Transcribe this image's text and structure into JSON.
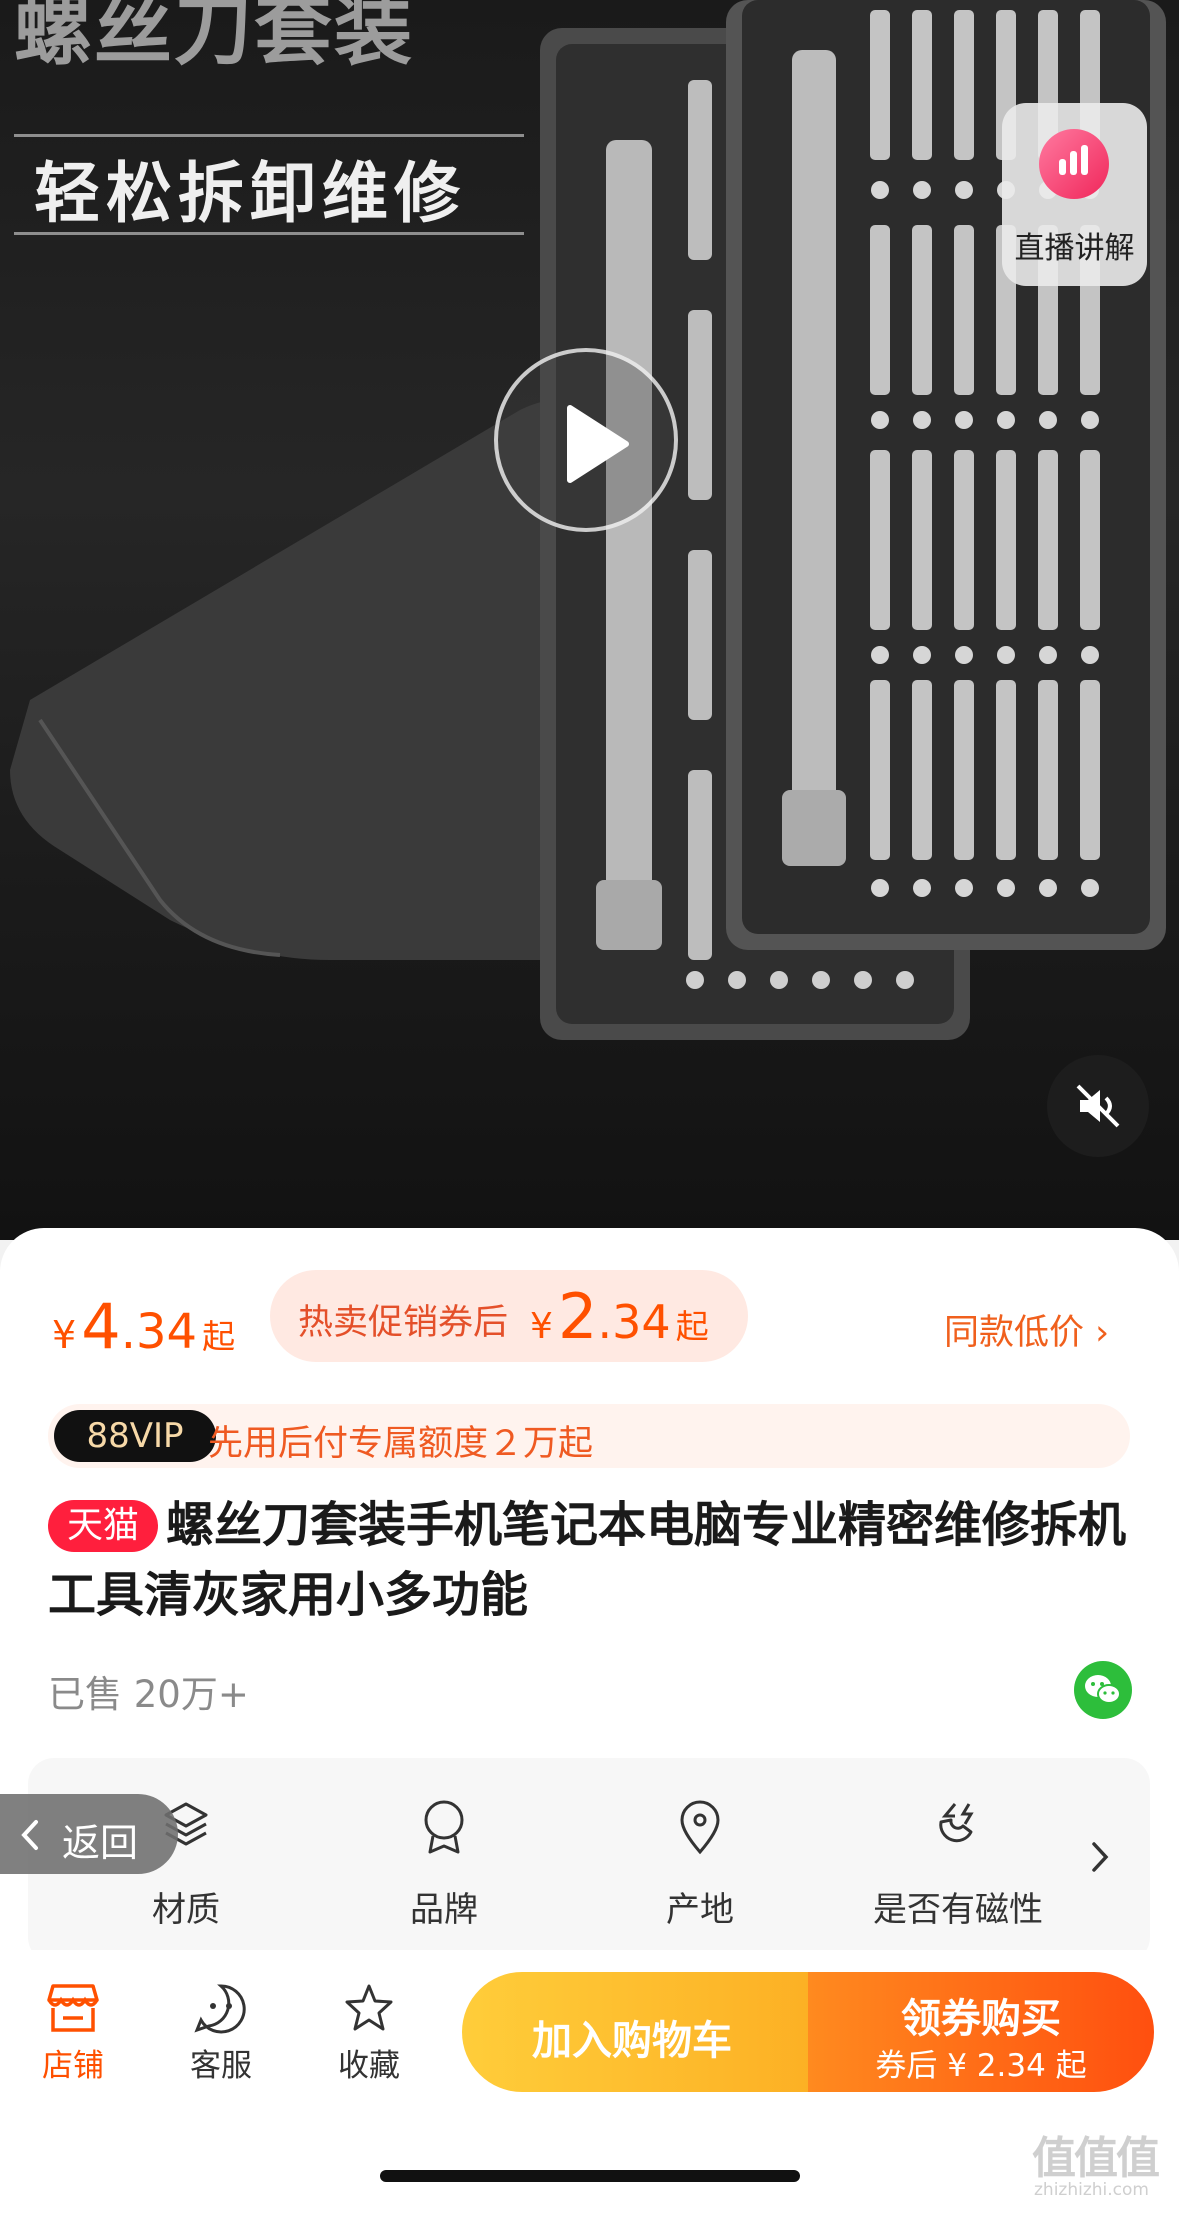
{
  "hero": {
    "headline": "螺丝刀套装",
    "subheadline": "轻松拆卸维修",
    "live_badge_label": "直播讲解"
  },
  "price": {
    "currency": "¥",
    "integer": "4",
    "decimal": ".34",
    "suffix": "起"
  },
  "promo": {
    "label": "热卖促销券后",
    "currency": "¥",
    "integer": "2",
    "decimal": ".34",
    "suffix": "起"
  },
  "same_price_link": "同款低价 ›",
  "vip": {
    "badge": "88VIP",
    "text": "先用后付专属额度２万起"
  },
  "product": {
    "tag": "天猫",
    "title": "螺丝刀套装手机笔记本电脑专业精密维修拆机工具清灰家用小多功能",
    "sold": "已售 20万+"
  },
  "attributes": [
    {
      "label": "材质",
      "icon": "layers-icon"
    },
    {
      "label": "品牌",
      "icon": "award-icon"
    },
    {
      "label": "产地",
      "icon": "location-icon"
    },
    {
      "label": "是否有磁性",
      "icon": "magnet-icon"
    }
  ],
  "back_button": {
    "label": "返回"
  },
  "bottom_bar": {
    "shop": "店铺",
    "service": "客服",
    "favorite": "收藏",
    "add_to_cart": "加入购物车",
    "buy_now": "领券购买",
    "buy_now_sub": "券后 ¥ 2.34 起"
  },
  "watermark": {
    "mark": "值值值",
    "url": "zhizhizhi.com"
  },
  "colors": {
    "accent": "#ff5000",
    "tmall_red": "#ff1f3d",
    "cart_yellow": "#fcac21",
    "buy_orange": "#ff4f0f",
    "share_green": "#2dbe3b"
  }
}
